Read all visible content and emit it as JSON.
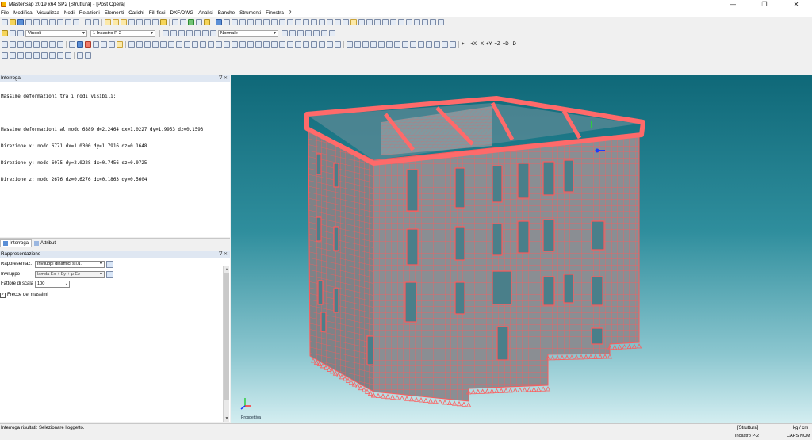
{
  "window": {
    "title": "MasterSap 2019 x64 SP2 [Struttura] - [Post Opera]",
    "minimize": "—",
    "maximize": "❐",
    "close": "✕"
  },
  "menu": [
    "File",
    "Modifica",
    "Visualizza",
    "Nodi",
    "Relazioni",
    "Elementi",
    "Carichi",
    "Fili fissi",
    "DXF/DWG",
    "Analisi",
    "Banche",
    "Strumenti",
    "Finestra",
    "?"
  ],
  "toolbar2": {
    "combo_vincoli": "Vincoli",
    "combo_incastro": "1 Incastro P-2",
    "combo_normale": "Normale"
  },
  "toolbar3": {
    "axis_plus": "+",
    "axis_minus": "-",
    "axis_x_plus": "+X",
    "axis_x_minus": "-X",
    "axis_y_plus": "+Y",
    "axis_z_plus": "+Z",
    "axis_d_plus": "+D",
    "axis_d_minus": "-D"
  },
  "interroga_panel": {
    "title": "Interroga",
    "buttons": "ᐁ ✕",
    "lines": [
      "Massime deformazioni tra i nodi visibili:",
      "",
      "Massime deformazioni al nodo 6889 d=2.2464 dx=1.0227 dy=1.9953 dz=0.1593",
      "Direzione x: nodo 6771 dx=1.0300 dy=1.7916 dz=0.1648",
      "Direzione y: nodo 6075 dy=2.0228 dx=0.7456 dz=0.0725",
      "Direzione z: nodo 2676 dz=0.6276 dx=0.1863 dy=0.5604"
    ]
  },
  "tabs": {
    "interroga": "Interroga",
    "attributi": "Attributi"
  },
  "rappresentazione_panel": {
    "title": "Rappresentazione",
    "buttons": "ᐁ ✕",
    "rappresentaz_label": "Rappresentaz.",
    "rappresentaz_value": "Inviluppi dinamici s.l.u.",
    "inviluppo_label": "Inviluppo",
    "inviluppo_value": "lamda Ex + Ey + μ Ez",
    "fattore_label": "Fattore di scala",
    "fattore_value": "100",
    "frecce_label": "Frecce dei massimi",
    "frecce_checked": true
  },
  "viewport": {
    "axes_label": "Prospettiva",
    "colors": {
      "mesh_fill": "#8a8e93",
      "mesh_line": "#ff5a5a",
      "top_beam": "#ff6a6a",
      "opening_fill": "#4a7f8a"
    }
  },
  "status": {
    "left": "Interroga risultati: Selezionare l'oggetto.",
    "mid": "[Struttura]",
    "right": "kg / cm",
    "line2_left": "",
    "line2_mid": "Incastro P-2",
    "line2_right": "CAPS NUM"
  }
}
